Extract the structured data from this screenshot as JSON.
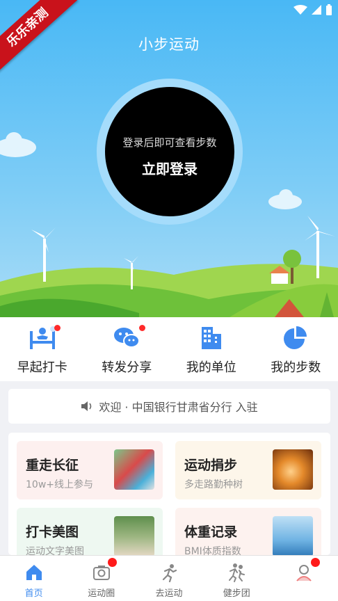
{
  "header": {
    "title": "小步运动",
    "ribbon": "乐乐亲测"
  },
  "hero": {
    "hint": "登录后即可查看步数",
    "login_button": "立即登录"
  },
  "quick_actions": [
    {
      "label": "早起打卡",
      "icon": "wake-up-icon",
      "badge": true
    },
    {
      "label": "转发分享",
      "icon": "wechat-icon",
      "badge": true
    },
    {
      "label": "我的单位",
      "icon": "building-icon",
      "badge": false
    },
    {
      "label": "我的步数",
      "icon": "pie-chart-icon",
      "badge": false
    }
  ],
  "notice": {
    "text": "欢迎 · 中国银行甘肃省分行 入驻"
  },
  "cards": [
    {
      "title": "重走长征",
      "subtitle": "10w+线上参与"
    },
    {
      "title": "运动捐步",
      "subtitle": "多走路勤种树"
    },
    {
      "title": "打卡美图",
      "subtitle": "运动文字美图"
    },
    {
      "title": "体重记录",
      "subtitle": "BMI体质指数"
    }
  ],
  "tabs": [
    {
      "label": "首页",
      "active": true
    },
    {
      "label": "运动圈",
      "badge": true
    },
    {
      "label": "去运动"
    },
    {
      "label": "健步团"
    },
    {
      "label": "",
      "badge": true
    }
  ],
  "colors": {
    "accent": "#3f8bef",
    "badge": "#ff1a1a",
    "ribbon": "#c9121b"
  }
}
